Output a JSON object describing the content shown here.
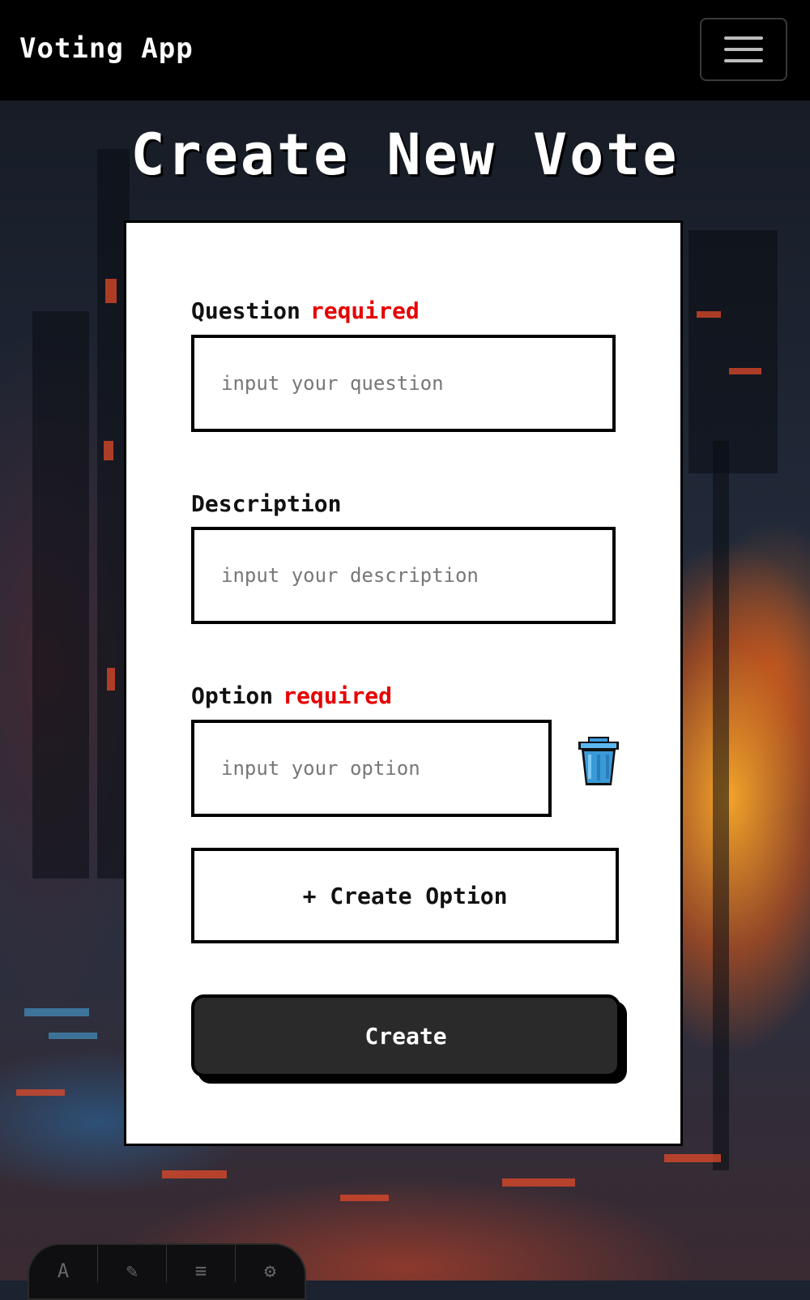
{
  "navbar": {
    "brand": "Voting App",
    "menu_icon": "hamburger-menu-icon"
  },
  "page": {
    "title": "Create New Vote"
  },
  "form": {
    "question": {
      "label": "Question",
      "required": "required",
      "placeholder": "input your question",
      "value": ""
    },
    "description": {
      "label": "Description",
      "placeholder": "input your description",
      "value": ""
    },
    "option": {
      "label": "Option",
      "required": "required",
      "placeholder": "input your option",
      "value": "",
      "delete_icon": "trash-icon"
    },
    "add_option_label": "+ Create Option",
    "submit_label": "Create"
  },
  "toolbar": {
    "icons": [
      "text-icon",
      "brush-icon",
      "notes-icon",
      "settings-icon"
    ]
  },
  "colors": {
    "required": "#e60000",
    "button_bg": "#2a2a2a",
    "trash": "#3a9ad9"
  }
}
